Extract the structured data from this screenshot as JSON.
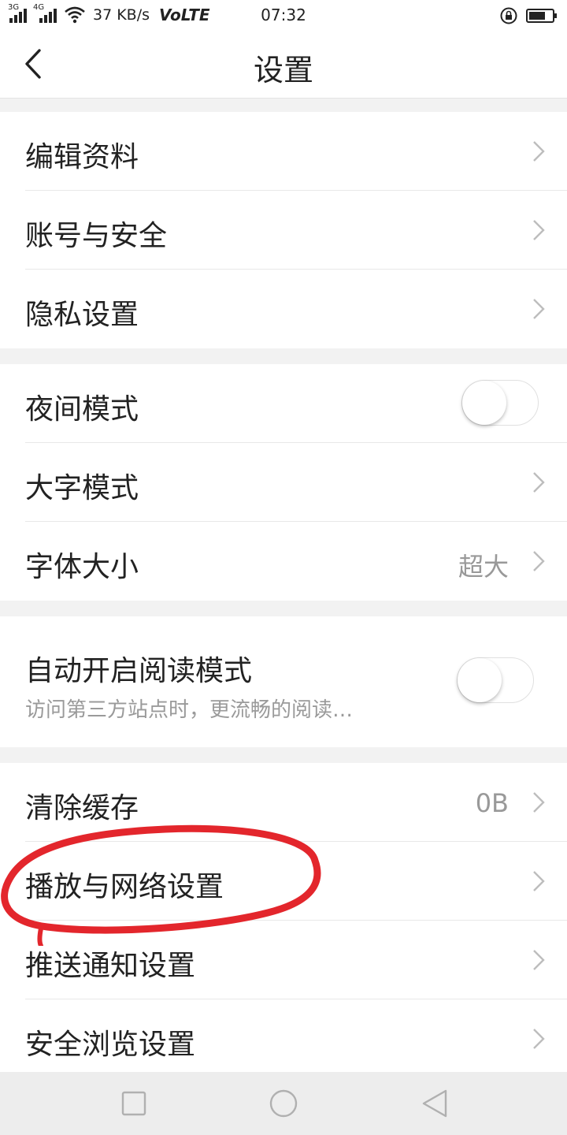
{
  "status_bar": {
    "signal_1_label": "3G",
    "signal_2_label": "4G",
    "speed": "37 KB/s",
    "volte": "VoLTE",
    "time": "07:32"
  },
  "header": {
    "title": "设置"
  },
  "groups": [
    {
      "items": [
        {
          "label": "编辑资料"
        },
        {
          "label": "账号与安全"
        },
        {
          "label": "隐私设置"
        }
      ]
    },
    {
      "items": [
        {
          "label": "夜间模式",
          "toggle": false
        },
        {
          "label": "大字模式"
        },
        {
          "label": "字体大小",
          "value": "超大"
        }
      ]
    },
    {
      "items": [
        {
          "label": "自动开启阅读模式",
          "sublabel": "访问第三方站点时，更流畅的阅读…",
          "toggle": false
        }
      ]
    },
    {
      "items": [
        {
          "label": "清除缓存",
          "value": "0B"
        },
        {
          "label": "播放与网络设置"
        },
        {
          "label": "推送通知设置"
        },
        {
          "label": "安全浏览设置"
        }
      ]
    }
  ],
  "colors": {
    "annotation_red": "#e3262c",
    "background": "#f2f2f2",
    "secondary_text": "#999999"
  },
  "icons": {
    "back": "chevron-left-icon",
    "row_arrow": "chevron-right-icon",
    "nav_recent": "square-icon",
    "nav_home": "circle-icon",
    "nav_back": "triangle-back-icon"
  }
}
